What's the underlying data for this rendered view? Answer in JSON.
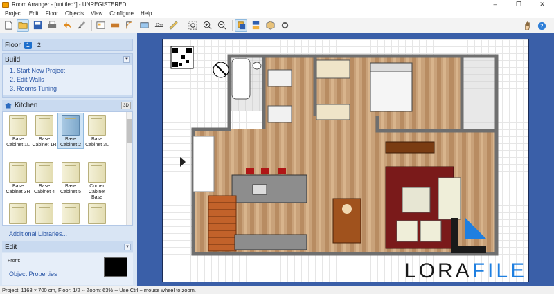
{
  "window": {
    "title": "Room Arranger - [untitled*] - UNREGISTERED",
    "controls": [
      "–",
      "❐",
      "✕"
    ]
  },
  "menu": [
    "Project",
    "Edit",
    "Floor",
    "Objects",
    "View",
    "Configure",
    "Help"
  ],
  "left_panel": {
    "floor": {
      "label": "Floor",
      "tabs": [
        "1",
        "2"
      ],
      "active": "1"
    },
    "build": {
      "label": "Build",
      "items": [
        "1. Start New Project",
        "2. Edit Walls",
        "3. Rooms Tuning"
      ]
    },
    "library": {
      "title": "Kitchen",
      "view3d": "3D",
      "items": [
        {
          "label": "Base Cabinet 1L"
        },
        {
          "label": "Base Cabinet 1R"
        },
        {
          "label": "Base Cabinet 2",
          "selected": true
        },
        {
          "label": "Base Cabinet 3L"
        },
        {
          "label": "Base Cabinet 3R"
        },
        {
          "label": "Base Cabinet 4"
        },
        {
          "label": "Base Cabinet 5"
        },
        {
          "label": "Corner Cabinet Base"
        }
      ],
      "additional": "Additional Libraries..."
    },
    "edit": {
      "label": "Edit",
      "front_label": "Front:",
      "front_color": "#000000",
      "object_properties": "Object Properties"
    }
  },
  "watermark": {
    "part1": "LORA",
    "part2": "FILE"
  },
  "status": "Project: 1168 × 700 cm, Floor: 1/2 -- Zoom: 63% -- Use Ctrl + mouse wheel to zoom."
}
